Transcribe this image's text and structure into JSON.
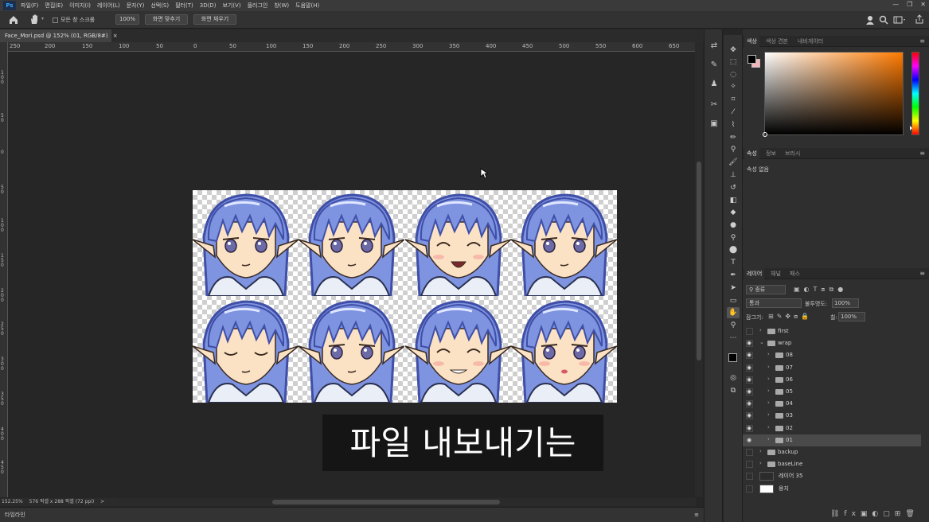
{
  "menubar": {
    "logo": "Ps",
    "items": [
      "파일(F)",
      "편집(E)",
      "이미지(I)",
      "레이어(L)",
      "문자(Y)",
      "선택(S)",
      "필터(T)",
      "3D(D)",
      "보기(V)",
      "플러그인",
      "창(W)",
      "도움말(H)"
    ],
    "min": "—",
    "max": "❐",
    "close": "✕"
  },
  "optionsbar": {
    "scroll_all": "모든 창 스크롤",
    "zoom": "100%",
    "fit_screen": "화면 맞추기",
    "fill_screen": "화면 채우기"
  },
  "document": {
    "tab_title": "Face_Mori.psd @ 152% (01, RGB/8#)",
    "close": "×"
  },
  "rulers": {
    "top": [
      "250",
      "200",
      "150",
      "100",
      "50",
      "0",
      "50",
      "100",
      "150",
      "200",
      "250",
      "300",
      "350",
      "400",
      "450",
      "500",
      "550",
      "600",
      "650"
    ],
    "left": [
      "1 0 0",
      "5 0",
      "0",
      "5 0",
      "1 0 0",
      "1 5 0",
      "2 0 0",
      "2 5 0",
      "3 0 0",
      "3 5 0",
      "4 0 0",
      "4 5 0"
    ]
  },
  "subtitle": "파일 내보내기는",
  "statusbar": {
    "zoom": "152.25%",
    "size": "576 픽셀 x 288 픽셀 (72 ppi)",
    "arrow": ">"
  },
  "timeline": "타임라인",
  "panels": {
    "color_tabs": [
      "색상",
      "색상 견본",
      "내비게이터"
    ],
    "props_tabs": [
      "속성",
      "정보",
      "브러시"
    ],
    "props_empty": "속성 없음",
    "layers_tabs": [
      "레이어",
      "채널",
      "패스"
    ],
    "filter_kind": "종류",
    "blend_mode": "통과",
    "opacity_label": "불투명도:",
    "opacity": "100%",
    "lock_label": "잠그기:",
    "fill_label": "칠:",
    "fill": "100%"
  },
  "layers": [
    {
      "name": "first",
      "visible": false,
      "type": "folder",
      "indent": 0
    },
    {
      "name": "wrap",
      "visible": true,
      "type": "folder-open",
      "indent": 0
    },
    {
      "name": "08",
      "visible": true,
      "type": "folder",
      "indent": 1
    },
    {
      "name": "07",
      "visible": true,
      "type": "folder",
      "indent": 1
    },
    {
      "name": "06",
      "visible": true,
      "type": "folder",
      "indent": 1
    },
    {
      "name": "05",
      "visible": true,
      "type": "folder",
      "indent": 1
    },
    {
      "name": "04",
      "visible": true,
      "type": "folder",
      "indent": 1
    },
    {
      "name": "03",
      "visible": true,
      "type": "folder",
      "indent": 1
    },
    {
      "name": "02",
      "visible": true,
      "type": "folder",
      "indent": 1
    },
    {
      "name": "01",
      "visible": true,
      "type": "folder",
      "indent": 1,
      "selected": true
    },
    {
      "name": "backup",
      "visible": false,
      "type": "folder",
      "indent": 0
    },
    {
      "name": "baseLine",
      "visible": false,
      "type": "folder",
      "indent": 0
    },
    {
      "name": "레이어 35",
      "visible": false,
      "type": "pixel",
      "indent": 0
    },
    {
      "name": "용지",
      "visible": false,
      "type": "paper",
      "indent": 0
    }
  ],
  "faces": [
    {
      "expression": "neutral"
    },
    {
      "expression": "smirk"
    },
    {
      "expression": "laugh"
    },
    {
      "expression": "serious"
    },
    {
      "expression": "eyes-closed"
    },
    {
      "expression": "sly"
    },
    {
      "expression": "grin"
    },
    {
      "expression": "blush"
    }
  ],
  "colors": {
    "hair": "#7f94e0",
    "hair_dark": "#3f4fa8",
    "skin": "#fbe2c4",
    "collar": "#e9eef7",
    "fg_swatch": "#000000",
    "bg_swatch": "#f2b6bd"
  }
}
